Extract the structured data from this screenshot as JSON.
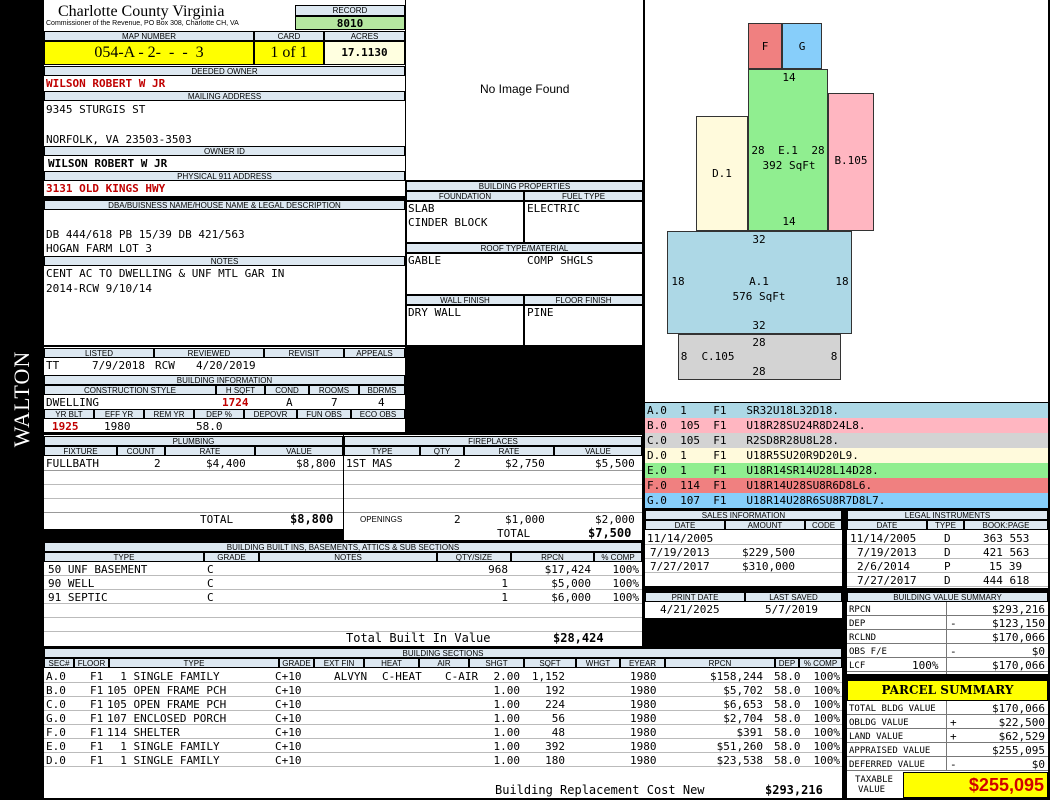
{
  "header": {
    "county": "Charlotte County Virginia",
    "commissioner": "Commissioner of the Revenue, PO Box 308, Charlotte CH, VA",
    "record_label": "RECORD",
    "record": "8010",
    "map_label": "MAP NUMBER",
    "map_number": "054-A - 2-  -  -  3",
    "card_label": "CARD",
    "card": "1 of 1",
    "acres_label": "ACRES",
    "acres": "17.1130"
  },
  "side_label": "WALTON",
  "owner": {
    "deeded_label": "DEEDED OWNER",
    "deeded": "WILSON ROBERT W JR",
    "mailing_label": "MAILING ADDRESS",
    "addr1": "9345 STURGIS ST",
    "addr2": "NORFOLK, VA 23503-3503",
    "owner_id_label": "OWNER ID",
    "owner_id": "WILSON ROBERT W JR",
    "phys_label": "PHYSICAL 911 ADDRESS",
    "phys": "3131 OLD KINGS HWY",
    "dba_label": "DBA/BUISNESS NAME/HOUSE NAME & LEGAL DESCRIPTION",
    "legal1": "DB 444/618 PB 15/39 DB 421/563",
    "legal2": "HOGAN FARM LOT 3",
    "notes_label": "NOTES",
    "note1": "CENT AC TO DWELLING & UNF MTL GAR IN",
    "note2": "2014-RCW 9/10/14"
  },
  "image_text": "No Image Found",
  "props": {
    "title": "BUILDING PROPERTIES",
    "foundation_label": "FOUNDATION",
    "fuel_label": "FUEL TYPE",
    "foundation1": "SLAB",
    "foundation2": "CINDER BLOCK",
    "fuel": "ELECTRIC",
    "roof_label": "ROOF TYPE/MATERIAL",
    "roof1": "GABLE",
    "roof2": "COMP SHGLS",
    "wall_label": "WALL FINISH",
    "floor_label": "FLOOR FINISH",
    "wall": "DRY WALL",
    "floor": "PINE"
  },
  "review": {
    "listed_label": "LISTED",
    "reviewed_label": "REVIEWED",
    "revisit_label": "REVISIT",
    "appeals_label": "APPEALS",
    "tt": "TT",
    "listed": "7/9/2018",
    "rcw": "RCW",
    "reviewed": "4/20/2019"
  },
  "bldg": {
    "title": "BUILDING INFORMATION",
    "style_label": "CONSTRUCTION STYLE",
    "hsqft_label": "H SQFT",
    "cond_label": "COND",
    "rooms_label": "ROOMS",
    "bdrms_label": "BDRMS",
    "style": "DWELLING",
    "hsqft": "1724",
    "cond": "A",
    "rooms": "7",
    "bdrms": "4",
    "yrblt_label": "YR BLT",
    "effyr_label": "EFF YR",
    "remyr_label": "REM YR",
    "dep_label": "DEP %",
    "depovr_label": "DEPOVR",
    "funobs_label": "FUN OBS",
    "ecoobs_label": "ECO OBS",
    "yrblt": "1925",
    "effyr": "1980",
    "dep": "58.0"
  },
  "plumbing": {
    "title": "PLUMBING",
    "h_fixture": "FIXTURE",
    "h_count": "COUNT",
    "h_rate": "RATE",
    "h_value": "VALUE",
    "fixture": "FULLBATH",
    "count": "2",
    "rate": "$4,400",
    "value": "$8,800",
    "total_label": "TOTAL",
    "total": "$8,800"
  },
  "fireplaces": {
    "title": "FIREPLACES",
    "h_type": "TYPE",
    "h_qty": "QTY",
    "h_rate": "RATE",
    "h_value": "VALUE",
    "type": "1ST MAS",
    "qty": "2",
    "rate": "$2,750",
    "value": "$5,500",
    "open_label": "OPENINGS",
    "open_qty": "2",
    "open_rate": "$1,000",
    "open_value": "$2,000",
    "total_label": "TOTAL",
    "total": "$7,500"
  },
  "builtins": {
    "title": "BUILDING BUILT INS, BASEMENTS, ATTICS & SUB SECTIONS",
    "h_type": "TYPE",
    "h_grade": "GRADE",
    "h_notes": "NOTES",
    "h_qty": "QTY/SIZE",
    "h_rpcn": "RPCN",
    "h_comp": "% COMP",
    "rows": [
      {
        "type": "50 UNF BASEMENT",
        "grade": "C",
        "qty": "968",
        "rpcn": "$17,424",
        "comp": "100%"
      },
      {
        "type": "90 WELL",
        "grade": "C",
        "qty": "1",
        "rpcn": "$5,000",
        "comp": "100%"
      },
      {
        "type": "91 SEPTIC",
        "grade": "C",
        "qty": "1",
        "rpcn": "$6,000",
        "comp": "100%"
      }
    ],
    "total_label": "Total Built In Value",
    "total": "$28,424"
  },
  "sections": {
    "title": "BUILDING SECTIONS",
    "h": [
      "SEC#",
      "FLOOR",
      "TYPE",
      "GRADE",
      "EXT FIN",
      "HEAT",
      "AIR",
      "SHGT",
      "SQFT",
      "WHGT",
      "EYEAR",
      "RPCN",
      "DEP",
      "% COMP"
    ],
    "rows": [
      {
        "sec": "A.0",
        "floor": "F1",
        "type": "  1 SINGLE FAMILY",
        "grade": "C+10",
        "ext": "ALVYN",
        "heat": "C-HEAT",
        "air": "C-AIR",
        "shgt": "2.00",
        "sqft": "1,152",
        "eyear": "1980",
        "rpcn": "$158,244",
        "dep": "58.0",
        "comp": "100%"
      },
      {
        "sec": "B.0",
        "floor": "F1",
        "type": "105 OPEN FRAME PCH",
        "grade": "C+10",
        "ext": "",
        "heat": "",
        "air": "",
        "shgt": "1.00",
        "sqft": "192",
        "eyear": "1980",
        "rpcn": "$5,702",
        "dep": "58.0",
        "comp": "100%"
      },
      {
        "sec": "C.0",
        "floor": "F1",
        "type": "105 OPEN FRAME PCH",
        "grade": "C+10",
        "ext": "",
        "heat": "",
        "air": "",
        "shgt": "1.00",
        "sqft": "224",
        "eyear": "1980",
        "rpcn": "$6,653",
        "dep": "58.0",
        "comp": "100%"
      },
      {
        "sec": "G.0",
        "floor": "F1",
        "type": "107 ENCLOSED PORCH",
        "grade": "C+10",
        "ext": "",
        "heat": "",
        "air": "",
        "shgt": "1.00",
        "sqft": "56",
        "eyear": "1980",
        "rpcn": "$2,704",
        "dep": "58.0",
        "comp": "100%"
      },
      {
        "sec": "F.0",
        "floor": "F1",
        "type": "114 SHELTER",
        "grade": "C+10",
        "ext": "",
        "heat": "",
        "air": "",
        "shgt": "1.00",
        "sqft": "48",
        "eyear": "1980",
        "rpcn": "$391",
        "dep": "58.0",
        "comp": "100%"
      },
      {
        "sec": "E.0",
        "floor": "F1",
        "type": "  1 SINGLE FAMILY",
        "grade": "C+10",
        "ext": "",
        "heat": "",
        "air": "",
        "shgt": "1.00",
        "sqft": "392",
        "eyear": "1980",
        "rpcn": "$51,260",
        "dep": "58.0",
        "comp": "100%"
      },
      {
        "sec": "D.0",
        "floor": "F1",
        "type": "  1 SINGLE FAMILY",
        "grade": "C+10",
        "ext": "",
        "heat": "",
        "air": "",
        "shgt": "1.00",
        "sqft": "180",
        "eyear": "1980",
        "rpcn": "$23,538",
        "dep": "58.0",
        "comp": "100%"
      }
    ],
    "brcn_label": "Building Replacement Cost New",
    "brcn": "$293,216"
  },
  "sketch": {
    "F": "F",
    "G": "G",
    "dim14a": "14",
    "e1": "E.1",
    "e1sq": "392 SqFt",
    "e28a": "28",
    "e28b": "28",
    "dim14b": "14",
    "d1": "D.1",
    "b105": "B.105",
    "dim32a": "32",
    "a1": "A.1",
    "a1sq": "576 SqFt",
    "a18a": "18",
    "a18b": "18",
    "dim32b": "32",
    "c105": "C.105",
    "c28a": "28",
    "c28b": "28",
    "c8a": "8",
    "c8b": "8"
  },
  "sketch_colors": {
    "A": "#add8e6",
    "B": "#ffb6c1",
    "C": "#d3d3d3",
    "D": "#fffadc",
    "E": "#90ee90",
    "F": "#f08080",
    "G": "#87cefa"
  },
  "instructions": [
    {
      "text": "A.0  1    F1   SR32U18L32D18.",
      "color": "#add8e6"
    },
    {
      "text": "B.0  105  F1   U18R28SU24R8D24L8.",
      "color": "#ffb6c1"
    },
    {
      "text": "C.0  105  F1   R2SD8R28U8L28.",
      "color": "#d3d3d3"
    },
    {
      "text": "D.0  1    F1   U18R5SU20R9D20L9.",
      "color": "#fffadc"
    },
    {
      "text": "E.0  1    F1   U18R14SR14U28L14D28.",
      "color": "#90ee90"
    },
    {
      "text": "F.0  114  F1   U18R14U28SU8R6D8L6.",
      "color": "#f08080"
    },
    {
      "text": "G.0  107  F1   U18R14U28R6SU8R7D8L7.",
      "color": "#87cefa"
    }
  ],
  "sales": {
    "title": "SALES INFORMATION",
    "h_date": "DATE",
    "h_amount": "AMOUNT",
    "h_code": "CODE",
    "rows": [
      {
        "date": "11/14/2005",
        "amount": ""
      },
      {
        "date": "7/19/2013",
        "amount": "$229,500"
      },
      {
        "date": "7/27/2017",
        "amount": "$310,000"
      }
    ]
  },
  "legal": {
    "title": "LEGAL INSTRUMENTS",
    "h_date": "DATE",
    "h_type": "TYPE",
    "h_book": "BOOK:PAGE",
    "rows": [
      {
        "date": "11/14/2005",
        "type": "D",
        "book": "363 553"
      },
      {
        "date": "7/19/2013",
        "type": "D",
        "book": "421 563"
      },
      {
        "date": "2/6/2014",
        "type": "P",
        "book": "15 39"
      },
      {
        "date": "7/27/2017",
        "type": "D",
        "book": "444 618"
      }
    ]
  },
  "print": {
    "print_label": "PRINT DATE",
    "saved_label": "LAST SAVED",
    "print_date": "4/21/2025",
    "saved": "5/7/2019"
  },
  "bvs": {
    "title": "BUILDING VALUE SUMMARY",
    "rpcn_label": "RPCN",
    "rpcn": "$293,216",
    "dep_label": "DEP",
    "dep_sign": "-",
    "dep": "$123,150",
    "rclnd_label": "RCLND",
    "rclnd": "$170,066",
    "obs_label": "OBS F/E",
    "obs_sign": "-",
    "obs": "$0",
    "lcf_label": "LCF",
    "lcf_pct": "100%",
    "lcf": "$170,066"
  },
  "parcel": {
    "title": "PARCEL SUMMARY",
    "tbv_label": "TOTAL BLDG VALUE",
    "tbv": "$170,066",
    "obldg_label": "OBLDG VALUE",
    "obldg_sign": "+",
    "obldg": "$22,500",
    "land_label": "LAND VALUE",
    "land_sign": "+",
    "land": "$62,529",
    "appr_label": "APPRAISED VALUE",
    "appr": "$255,095",
    "def_label": "DEFERRED VALUE",
    "def_sign": "-",
    "def": "$0",
    "taxable_label1": "TAXABLE",
    "taxable_label2": "VALUE",
    "taxable": "$255,095"
  }
}
